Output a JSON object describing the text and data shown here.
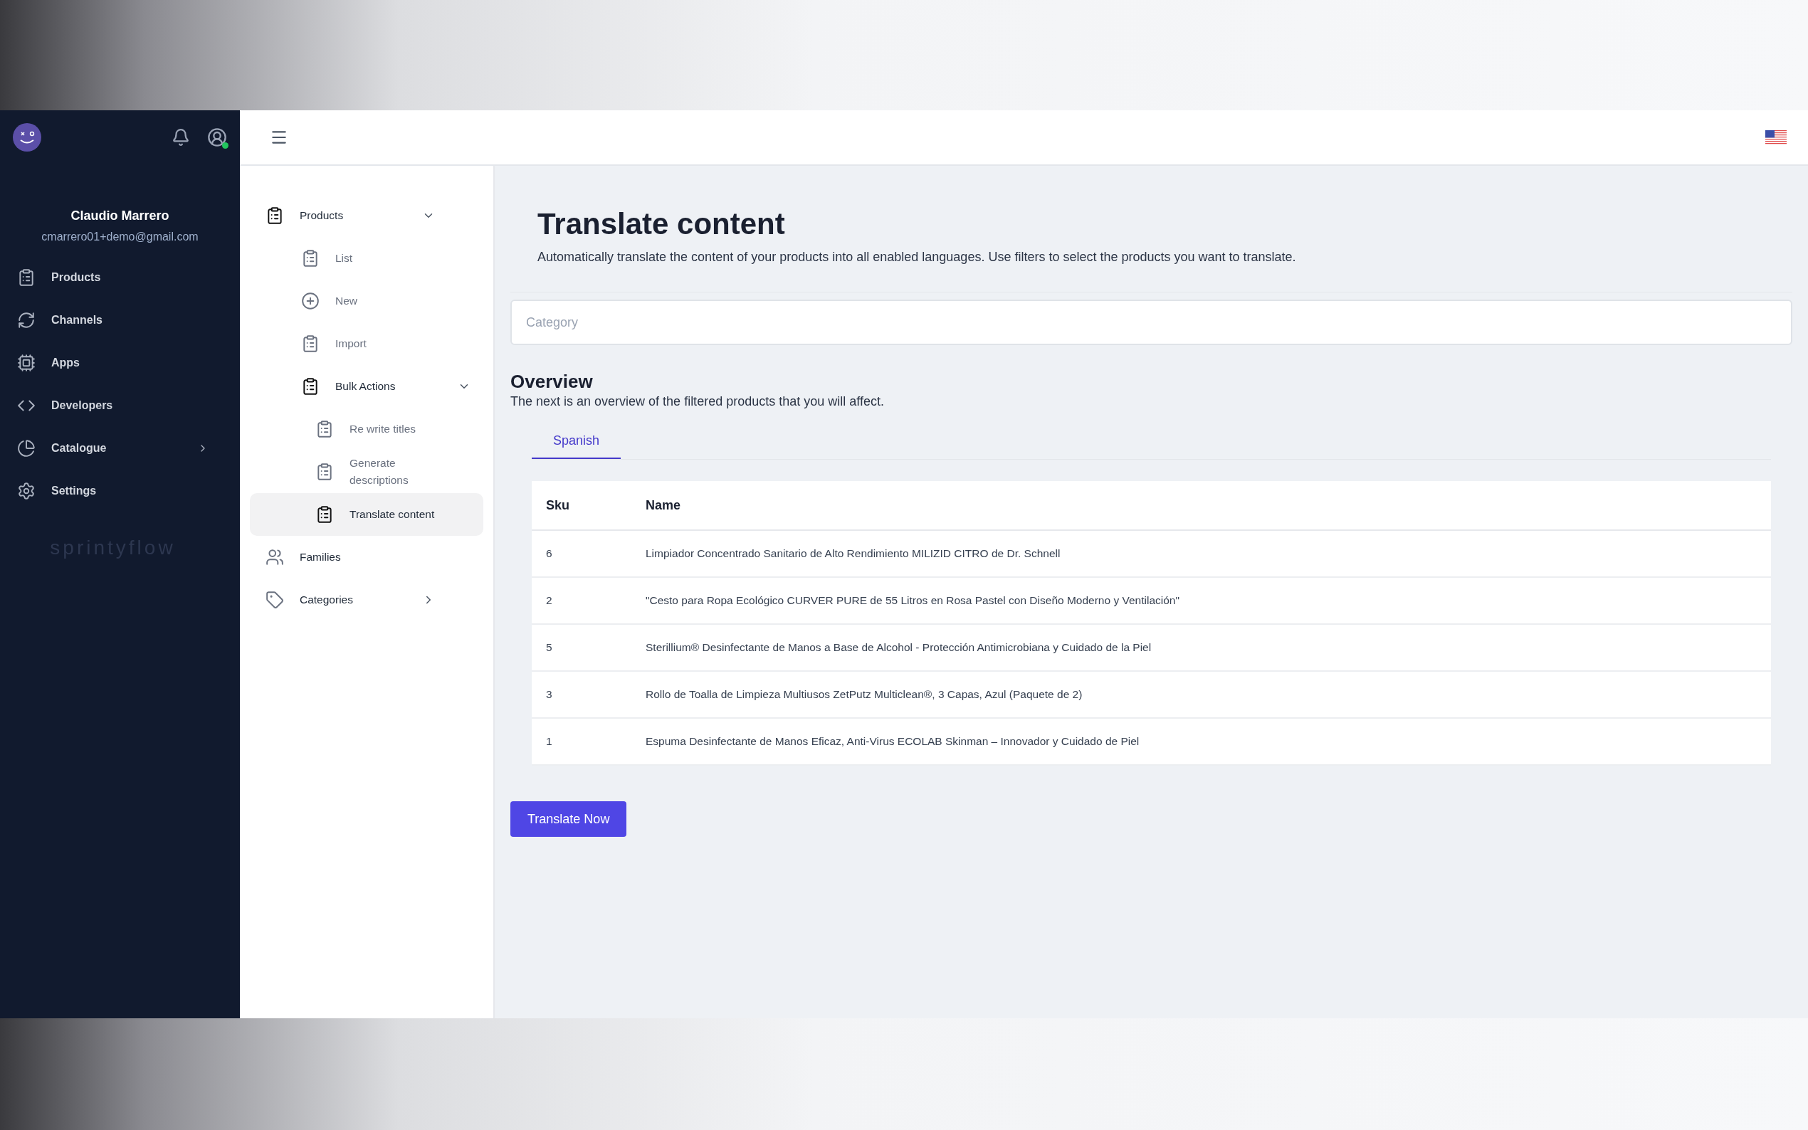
{
  "sidebar": {
    "online": true,
    "user_name": "Claudio Marrero",
    "user_email": "cmarrero01+demo@gmail.com",
    "items": [
      {
        "label": "Products",
        "kind": "clipboard",
        "expandable": false
      },
      {
        "label": "Channels",
        "kind": "refresh",
        "expandable": false
      },
      {
        "label": "Apps",
        "kind": "chip",
        "expandable": false
      },
      {
        "label": "Developers",
        "kind": "code",
        "expandable": false
      },
      {
        "label": "Catalogue",
        "kind": "pie",
        "expandable": true
      },
      {
        "label": "Settings",
        "kind": "gear",
        "expandable": false
      }
    ],
    "brand": "sprintyflow"
  },
  "submenu": [
    {
      "label": "Products",
      "kind": "clipboard",
      "expandable": true,
      "expanded": true,
      "selected": false,
      "children": [
        {
          "label": "List",
          "kind": "clipboard",
          "expandable": false,
          "selected": false
        },
        {
          "label": "New",
          "kind": "plus",
          "expandable": false,
          "selected": false
        },
        {
          "label": "Import",
          "kind": "clipboard",
          "expandable": false,
          "selected": false
        },
        {
          "label": "Bulk Actions",
          "kind": "clipboard",
          "expandable": true,
          "expanded": true,
          "selected": false,
          "children": [
            {
              "label": "Re write titles",
              "kind": "clipboard",
              "expandable": false,
              "selected": false
            },
            {
              "label": "Generate descriptions",
              "kind": "clipboard",
              "expandable": false,
              "selected": false
            },
            {
              "label": "Translate content",
              "kind": "clipboard",
              "expandable": false,
              "selected": true
            }
          ]
        }
      ]
    },
    {
      "label": "Families",
      "kind": "users",
      "expandable": false,
      "selected": false
    },
    {
      "label": "Categories",
      "kind": "tag",
      "expandable": true,
      "expanded": false,
      "selected": false
    }
  ],
  "page": {
    "title": "Translate content",
    "description": "Automatically translate the content of your products into all enabled languages. Use filters to select the products you want to translate.",
    "category_filter": {
      "placeholder": "Category"
    },
    "overview_title": "Overview",
    "overview_description": "The next is an overview of the filtered products that you will affect.",
    "tabs": [
      {
        "label": "Spanish",
        "selected": true
      }
    ],
    "table": {
      "columns": [
        "Sku",
        "Name"
      ],
      "rows": [
        [
          "6",
          "Limpiador Concentrado Sanitario de Alto Rendimiento MILIZID CITRO de Dr. Schnell"
        ],
        [
          "2",
          "\"Cesto para Ropa Ecológico CURVER PURE de 55 Litros en Rosa Pastel con Diseño Moderno y Ventilación\""
        ],
        [
          "5",
          "Sterillium® Desinfectante de Manos a Base de Alcohol - Protección Antimicrobiana y Cuidado de la Piel"
        ],
        [
          "3",
          "Rollo de Toalla de Limpieza Multiusos ZetPutz Multiclean®, 3 Capas, Azul (Paquete de 2)"
        ],
        [
          "1",
          "Espuma Desinfectante de Manos Eficaz, Anti-Virus ECOLAB Skinman – Innovador y Cuidado de Piel"
        ]
      ]
    },
    "action_button": "Translate Now"
  }
}
